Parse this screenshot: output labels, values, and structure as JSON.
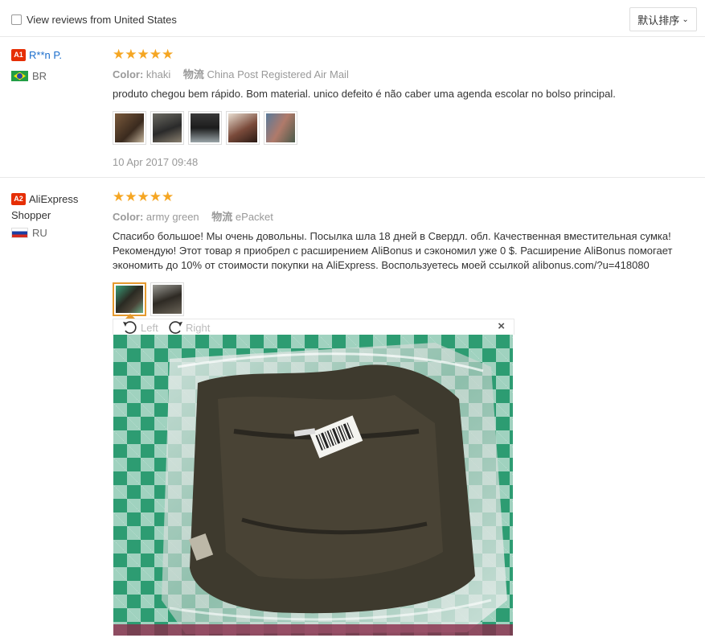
{
  "filter": {
    "label": "View reviews from United States",
    "checked": false
  },
  "sort": {
    "label": "默认排序"
  },
  "reviews": [
    {
      "badge": "A1",
      "user": "R**n P.",
      "country": "BR",
      "rating": "★★★★★",
      "color_label": "Color:",
      "color_value": "khaki",
      "shipping_label": "物流",
      "shipping_value": "China Post Registered Air Mail",
      "text": "produto chegou bem rápido. Bom material. unico defeito é não caber uma agenda escolar no bolso principal.",
      "date": "10 Apr 2017 09:48"
    },
    {
      "badge": "A2",
      "user": "AliExpress Shopper",
      "country": "RU",
      "rating": "★★★★★",
      "color_label": "Color:",
      "color_value": "army green",
      "shipping_label": "物流",
      "shipping_value": "ePacket",
      "text": "Спасибо большое! Мы очень довольны. Посылка шла 18 дней в Свердл. обл. Качественная вместительная сумка! Рекомендую! Этот товар я приобрел с расширением AliBonus и сэкономил уже 0 $. Расширение AliBonus помогает экономить до 10% от стоимости покупки на AliExpress. Воспользуетесь моей ссылкой alibonus.com/?u=418080"
    }
  ],
  "viewer": {
    "rotate_left": "Left",
    "rotate_right": "Right",
    "close": "×"
  },
  "colors": {
    "accent": "#e62e04",
    "star": "#f5a623",
    "link": "#1a6dcc",
    "selected": "#e59a2f"
  }
}
